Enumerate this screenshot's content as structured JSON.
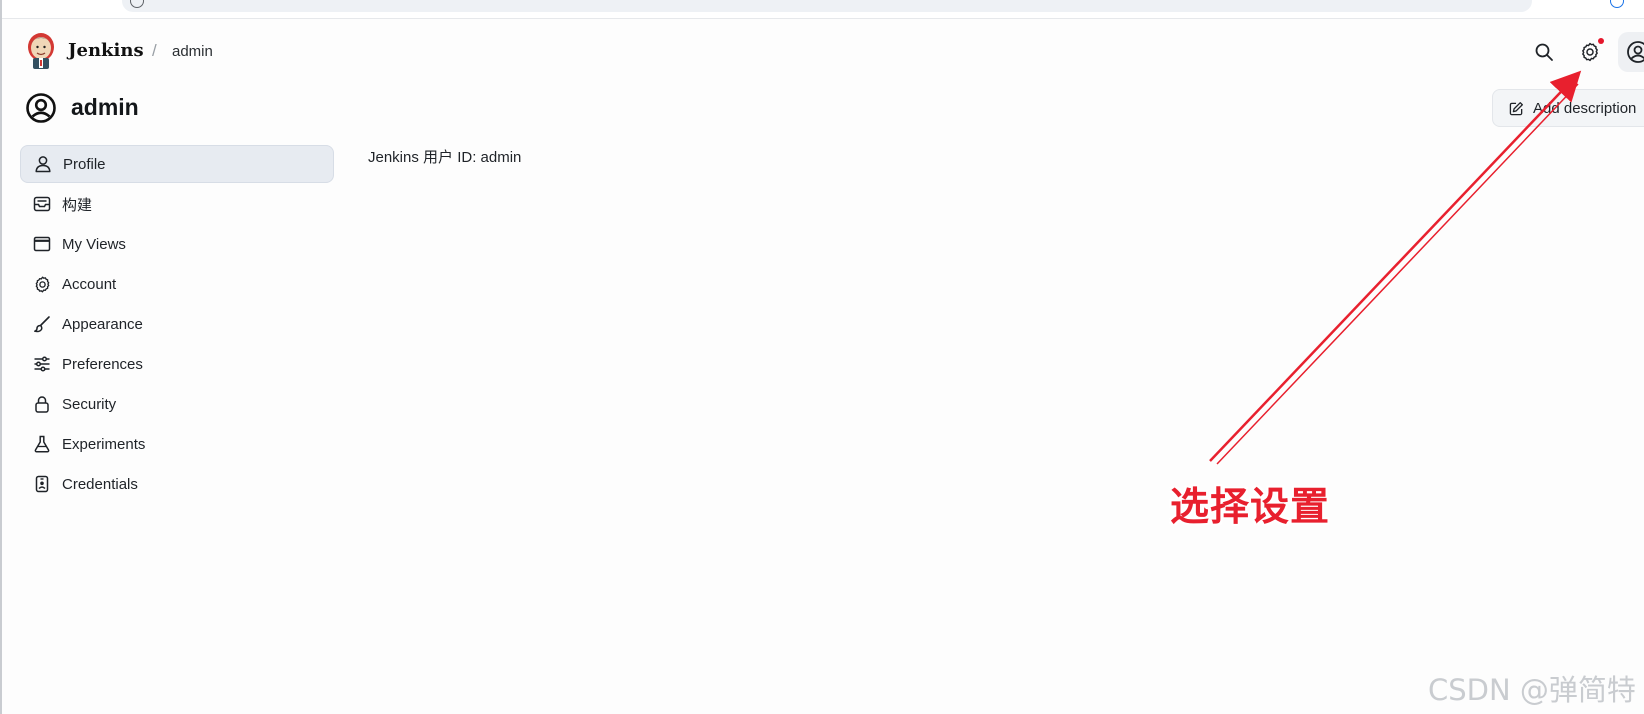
{
  "header": {
    "brand": "Jenkins",
    "breadcrumb_separator": "/",
    "breadcrumb_current": "admin",
    "icons": {
      "search": "search-icon",
      "settings": "gear-icon",
      "user": "user-circle-icon"
    },
    "notification_color": "#e5162b"
  },
  "page": {
    "title": "admin",
    "add_description_label": "Add description",
    "user_id_text": "Jenkins 用户 ID: admin"
  },
  "sidebar": {
    "items": [
      {
        "label": "Profile",
        "icon": "person-icon",
        "active": true
      },
      {
        "label": "构建",
        "icon": "inbox-icon",
        "active": false
      },
      {
        "label": "My Views",
        "icon": "window-icon",
        "active": false
      },
      {
        "label": "Account",
        "icon": "gear-icon",
        "active": false
      },
      {
        "label": "Appearance",
        "icon": "brush-icon",
        "active": false
      },
      {
        "label": "Preferences",
        "icon": "sliders-icon",
        "active": false
      },
      {
        "label": "Security",
        "icon": "lock-icon",
        "active": false
      },
      {
        "label": "Experiments",
        "icon": "flask-icon",
        "active": false
      },
      {
        "label": "Credentials",
        "icon": "id-badge-icon",
        "active": false
      }
    ]
  },
  "annotation": {
    "label": "选择设置",
    "color": "#e8202e"
  },
  "watermark": "CSDN @弹简特"
}
